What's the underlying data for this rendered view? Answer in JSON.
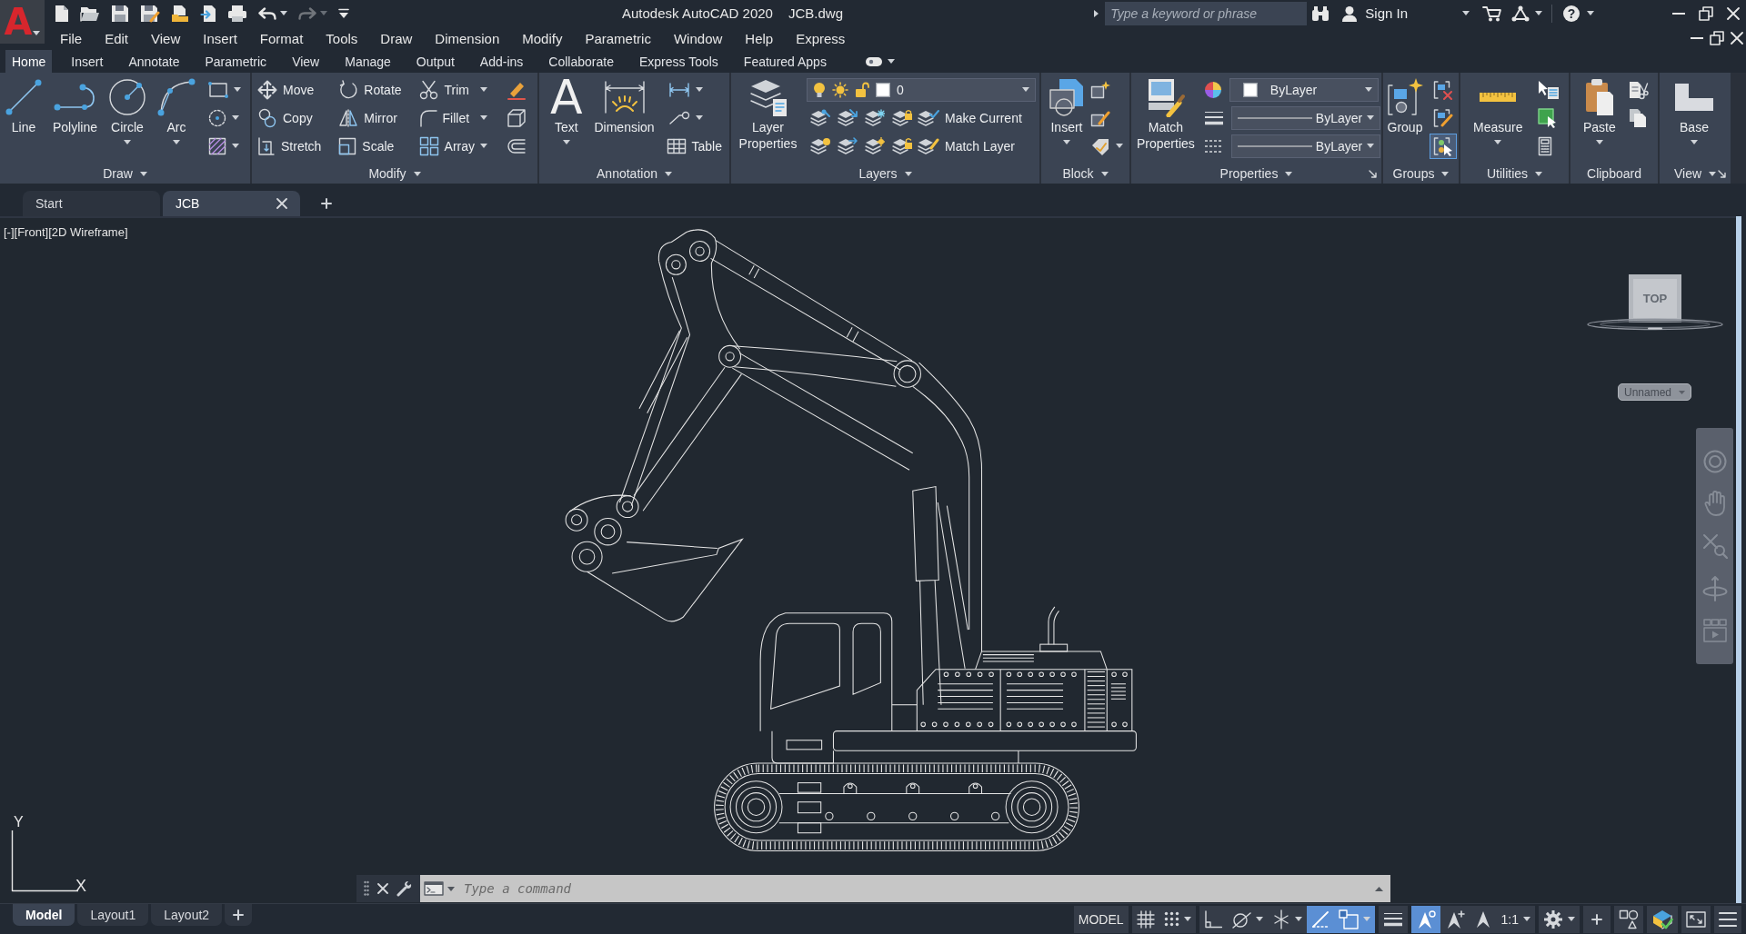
{
  "app_button": {
    "glyph": "A"
  },
  "quick_access": [
    {
      "disabled": false
    },
    {
      "disabled": false
    },
    {
      "disabled": false
    },
    {
      "disabled": false
    },
    {
      "disabled": false
    },
    {
      "disabled": false
    },
    {
      "disabled": false
    },
    {
      "disabled": false,
      "menu": true
    },
    {
      "disabled": true,
      "menu": true
    },
    {
      "disabled": false
    }
  ],
  "window": {
    "title": "Autodesk AutoCAD 2020",
    "document": "JCB.dwg"
  },
  "search": {
    "placeholder": "Type a keyword or phrase"
  },
  "account": {
    "label": "Sign In"
  },
  "help": {
    "glyph": "?"
  },
  "menu_bar": [
    "File",
    "Edit",
    "View",
    "Insert",
    "Format",
    "Tools",
    "Draw",
    "Dimension",
    "Modify",
    "Parametric",
    "Window",
    "Help",
    "Express"
  ],
  "ribbon_tabs": [
    {
      "label": "Home",
      "selected": true
    },
    {
      "label": "Insert",
      "selected": false
    },
    {
      "label": "Annotate",
      "selected": false
    },
    {
      "label": "Parametric",
      "selected": false
    },
    {
      "label": "View",
      "selected": false
    },
    {
      "label": "Manage",
      "selected": false
    },
    {
      "label": "Output",
      "selected": false
    },
    {
      "label": "Add-ins",
      "selected": false
    },
    {
      "label": "Collaborate",
      "selected": false
    },
    {
      "label": "Express Tools",
      "selected": false
    },
    {
      "label": "Featured Apps",
      "selected": false
    }
  ],
  "ribbon_panels": [
    {
      "title": "Draw",
      "menu": true,
      "columns": [
        [
          [
            {
              "kind": "large",
              "label": "Line"
            }
          ]
        ],
        [
          [
            {
              "kind": "large",
              "label": "Polyline"
            }
          ]
        ],
        [
          [
            {
              "kind": "large",
              "label": "Circle",
              "menu": true
            }
          ]
        ],
        [
          [
            {
              "kind": "large",
              "label": "Arc",
              "menu": true
            }
          ]
        ],
        [
          [
            {
              "kind": "icon",
              "menu": true
            }
          ],
          [
            {
              "kind": "icon",
              "menu": true
            }
          ],
          [
            {
              "kind": "icon",
              "menu": true
            }
          ]
        ]
      ]
    },
    {
      "title": "Modify",
      "menu": true,
      "columns": [
        [
          [
            {
              "kind": "small",
              "label": "Move"
            }
          ],
          [
            {
              "kind": "small",
              "label": "Copy"
            }
          ],
          [
            {
              "kind": "small",
              "label": "Stretch"
            }
          ]
        ],
        [
          [
            {
              "kind": "small",
              "label": "Rotate"
            }
          ],
          [
            {
              "kind": "small",
              "label": "Mirror"
            }
          ],
          [
            {
              "kind": "small",
              "label": "Scale"
            }
          ]
        ],
        [
          [
            {
              "kind": "small",
              "label": "Trim",
              "menu": true
            }
          ],
          [
            {
              "kind": "small",
              "label": "Fillet",
              "menu": true
            }
          ],
          [
            {
              "kind": "small",
              "label": "Array",
              "menu": true
            }
          ]
        ],
        [
          [
            {
              "kind": "icon"
            }
          ],
          [
            {
              "kind": "icon"
            }
          ],
          [
            {
              "kind": "icon"
            }
          ]
        ]
      ]
    },
    {
      "title": "Annotation",
      "menu": true,
      "columns": [
        [
          [
            {
              "kind": "large",
              "label": "Text",
              "glyph": "A",
              "menu": true
            }
          ]
        ],
        [
          [
            {
              "kind": "large",
              "label": "Dimension"
            }
          ]
        ],
        [
          [
            {
              "kind": "icon",
              "menu": true
            }
          ],
          [
            {
              "kind": "icon",
              "menu": true
            }
          ],
          [
            {
              "kind": "small",
              "label": "Table"
            }
          ]
        ]
      ]
    },
    {
      "title": "Layers",
      "menu": true,
      "columns": [
        [
          [
            {
              "kind": "large",
              "label": "Layer Properties"
            }
          ]
        ],
        [
          [
            {
              "kind": "layer-combo",
              "value": "0"
            }
          ],
          [
            {
              "kind": "icon"
            },
            {
              "kind": "icon"
            },
            {
              "kind": "icon"
            },
            {
              "kind": "icon"
            },
            {
              "kind": "small",
              "label": "Make Current"
            }
          ],
          [
            {
              "kind": "icon"
            },
            {
              "kind": "icon"
            },
            {
              "kind": "icon"
            },
            {
              "kind": "icon"
            },
            {
              "kind": "small",
              "label": "Match Layer"
            }
          ]
        ]
      ]
    },
    {
      "title": "Block",
      "menu": true,
      "columns": [
        [
          [
            {
              "kind": "large",
              "label": "Insert",
              "menu": true
            }
          ]
        ],
        [
          [
            {
              "kind": "icon"
            }
          ],
          [
            {
              "kind": "icon"
            }
          ],
          [
            {
              "kind": "icon",
              "menu": true
            }
          ]
        ]
      ]
    },
    {
      "title": "Properties",
      "menu": true,
      "launcher": true,
      "columns": [
        [
          [
            {
              "kind": "large",
              "label": "Match Properties"
            }
          ]
        ],
        [
          [
            {
              "kind": "icon"
            },
            {
              "kind": "color-combo",
              "value": "ByLayer"
            }
          ],
          [
            {
              "kind": "icon"
            },
            {
              "kind": "line-combo",
              "value": "ByLayer"
            }
          ],
          [
            {
              "kind": "icon"
            },
            {
              "kind": "line-combo",
              "value": "ByLayer"
            }
          ]
        ]
      ]
    },
    {
      "title": "Groups",
      "menu": true,
      "columns": [
        [
          [
            {
              "kind": "large",
              "label": "Group"
            }
          ]
        ],
        [
          [
            {
              "kind": "icon",
              "on": false
            }
          ],
          [
            {
              "kind": "icon",
              "on": false
            }
          ],
          [
            {
              "kind": "icon",
              "on": true
            }
          ]
        ]
      ]
    },
    {
      "title": "Utilities",
      "menu": true,
      "columns": [
        [
          [
            {
              "kind": "large",
              "label": "Measure",
              "menu": true
            }
          ]
        ],
        [
          [
            {
              "kind": "icon"
            }
          ],
          [
            {
              "kind": "icon"
            }
          ],
          [
            {
              "kind": "icon"
            }
          ]
        ]
      ]
    },
    {
      "title": "Clipboard",
      "columns": [
        [
          [
            {
              "kind": "large",
              "label": "Paste",
              "menu": true
            }
          ]
        ],
        [
          [
            {
              "kind": "icon"
            }
          ],
          [
            {
              "kind": "icon"
            }
          ]
        ]
      ]
    },
    {
      "title": "View",
      "menu": true,
      "launcher": true,
      "columns": [
        [
          [
            {
              "kind": "large",
              "label": "Base",
              "menu": true
            }
          ]
        ]
      ]
    }
  ],
  "file_tabs": [
    {
      "label": "Start",
      "selected": false,
      "closable": false
    },
    {
      "label": "JCB",
      "selected": true,
      "closable": true
    }
  ],
  "viewport": {
    "controls": [
      "[-]",
      "[Front]",
      "[2D Wireframe]"
    ],
    "view_cube": {
      "face": "TOP"
    },
    "ucs_menu": "Unnamed",
    "ucs_icon": {
      "y_label": "Y",
      "x_label": "X"
    }
  },
  "command_line": {
    "placeholder": "Type a command"
  },
  "layout_tabs": [
    {
      "label": "Model",
      "selected": true
    },
    {
      "label": "Layout1",
      "selected": false
    },
    {
      "label": "Layout2",
      "selected": false
    }
  ],
  "status_bar": [
    {
      "kind": "label",
      "label": "MODEL"
    },
    {
      "kind": "toggle",
      "on": false
    },
    {
      "kind": "toggle",
      "on": false,
      "menu": true
    },
    {
      "kind": "toggle",
      "on": false
    },
    {
      "kind": "toggle",
      "on": false,
      "menu": true
    },
    {
      "kind": "toggle",
      "on": false,
      "menu": true
    },
    {
      "kind": "toggle",
      "on": true
    },
    {
      "kind": "toggle",
      "on": true,
      "menu": true
    },
    {
      "kind": "toggle",
      "on": false
    },
    {
      "kind": "toggle",
      "on": true
    },
    {
      "kind": "toggle",
      "on": false
    },
    {
      "kind": "icon"
    },
    {
      "kind": "label",
      "label": "1:1",
      "menu": true
    },
    {
      "kind": "icon",
      "menu": true
    },
    {
      "kind": "icon"
    },
    {
      "kind": "icon"
    },
    {
      "kind": "icon"
    },
    {
      "kind": "icon"
    },
    {
      "kind": "icon"
    }
  ]
}
